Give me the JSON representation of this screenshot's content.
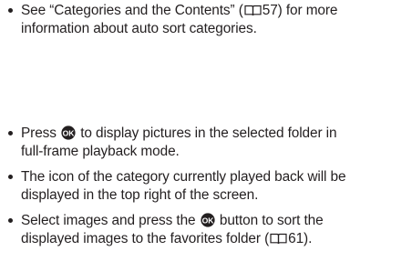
{
  "bullets": [
    {
      "line1_a": "See “Categories and the Contents” (",
      "line1_ref": "57",
      "line1_b": ") for more",
      "line2": "information about auto sort categories."
    },
    {
      "line1_a": "Press ",
      "line1_b": " to display pictures in the selected folder in",
      "line2": "full-frame playback mode."
    },
    {
      "line1": "The icon of the category currently played back will be",
      "line2": "displayed in the top right of the screen."
    },
    {
      "line1_a": "Select images and press the ",
      "line1_b": " button to sort the",
      "line2_a": "displayed images to the favorites folder (",
      "line2_ref": "61",
      "line2_b": ")."
    }
  ],
  "icons": {
    "reference_icon": "book-reference-icon",
    "ok_button_icon": "ok-button-icon",
    "ok_label": "OK"
  }
}
